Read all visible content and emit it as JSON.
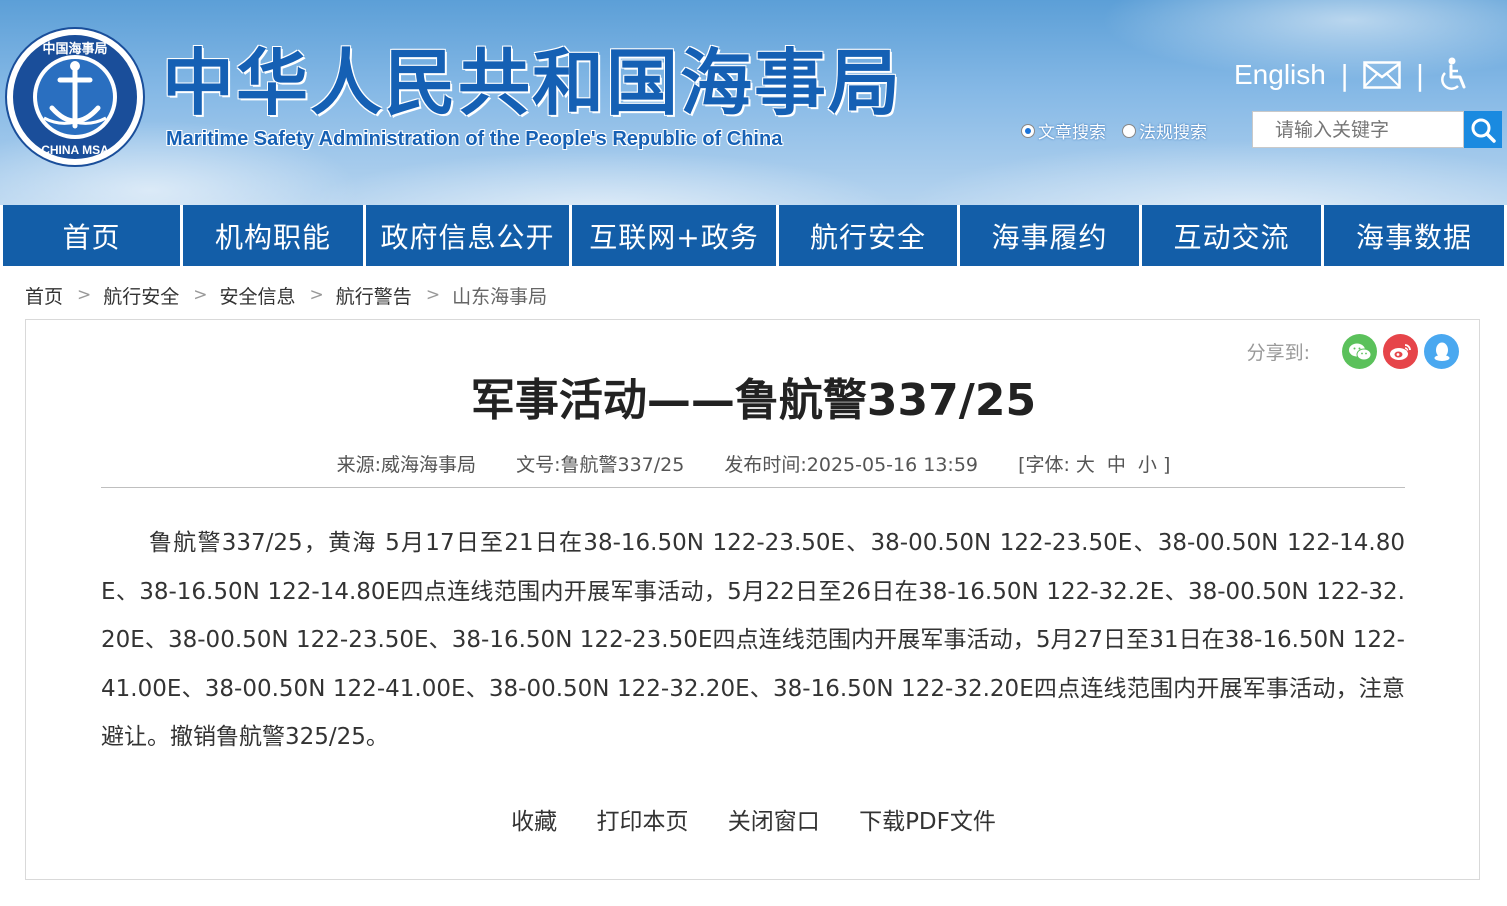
{
  "header": {
    "title_cn": "中华人民共和国海事局",
    "title_en": "Maritime Safety Administration of the People's Republic of China",
    "logo_text_top": "中国海事局",
    "logo_text_bottom": "CHINA MSA",
    "english_link": "English",
    "separator": "|",
    "search_options": [
      "文章搜索",
      "法规搜索"
    ],
    "search_selected": "文章搜索",
    "search_placeholder": "请输入关键字"
  },
  "nav": {
    "items": [
      "首页",
      "机构职能",
      "政府信息公开",
      "互联网+政务",
      "航行安全",
      "海事履约",
      "互动交流",
      "海事数据"
    ]
  },
  "breadcrumb": {
    "items": [
      "首页",
      "航行安全",
      "安全信息",
      "航行警告",
      "山东海事局"
    ],
    "separator": ">"
  },
  "article": {
    "share_label": "分享到:",
    "title": "军事活动——鲁航警337/25",
    "source_label": "来源:",
    "source": "威海海事局",
    "doc_no_label": "文号:",
    "doc_no": "鲁航警337/25",
    "publish_label": "发布时间:",
    "publish_time": "2025-05-16 13:59",
    "font_open": "[字体:",
    "font_large": "大",
    "font_medium": "中",
    "font_small": "小",
    "font_close": "]",
    "body": "鲁航警337/25，黄海 5月17日至21日在38-16.50N 122-23.50E、38-00.50N 122-23.50E、38-00.50N 122-14.80E、38-16.50N 122-14.80E四点连线范围内开展军事活动，5月22日至26日在38-16.50N 122-32.2E、38-00.50N 122-32.20E、38-00.50N 122-23.50E、38-16.50N 122-23.50E四点连线范围内开展军事活动，5月27日至31日在38-16.50N 122-41.00E、38-00.50N 122-41.00E、38-00.50N 122-32.20E、38-16.50N 122-32.20E四点连线范围内开展军事活动，注意避让。撤销鲁航警325/25。",
    "actions": [
      "收藏",
      "打印本页",
      "关闭窗口",
      "下载PDF文件"
    ]
  },
  "colors": {
    "nav_bg": "#135ea8",
    "title_blue": "#1560b4",
    "search_btn": "#1a8ae0",
    "wechat": "#5bc15b",
    "weibo": "#e6454a",
    "qq": "#4aa8f0"
  }
}
